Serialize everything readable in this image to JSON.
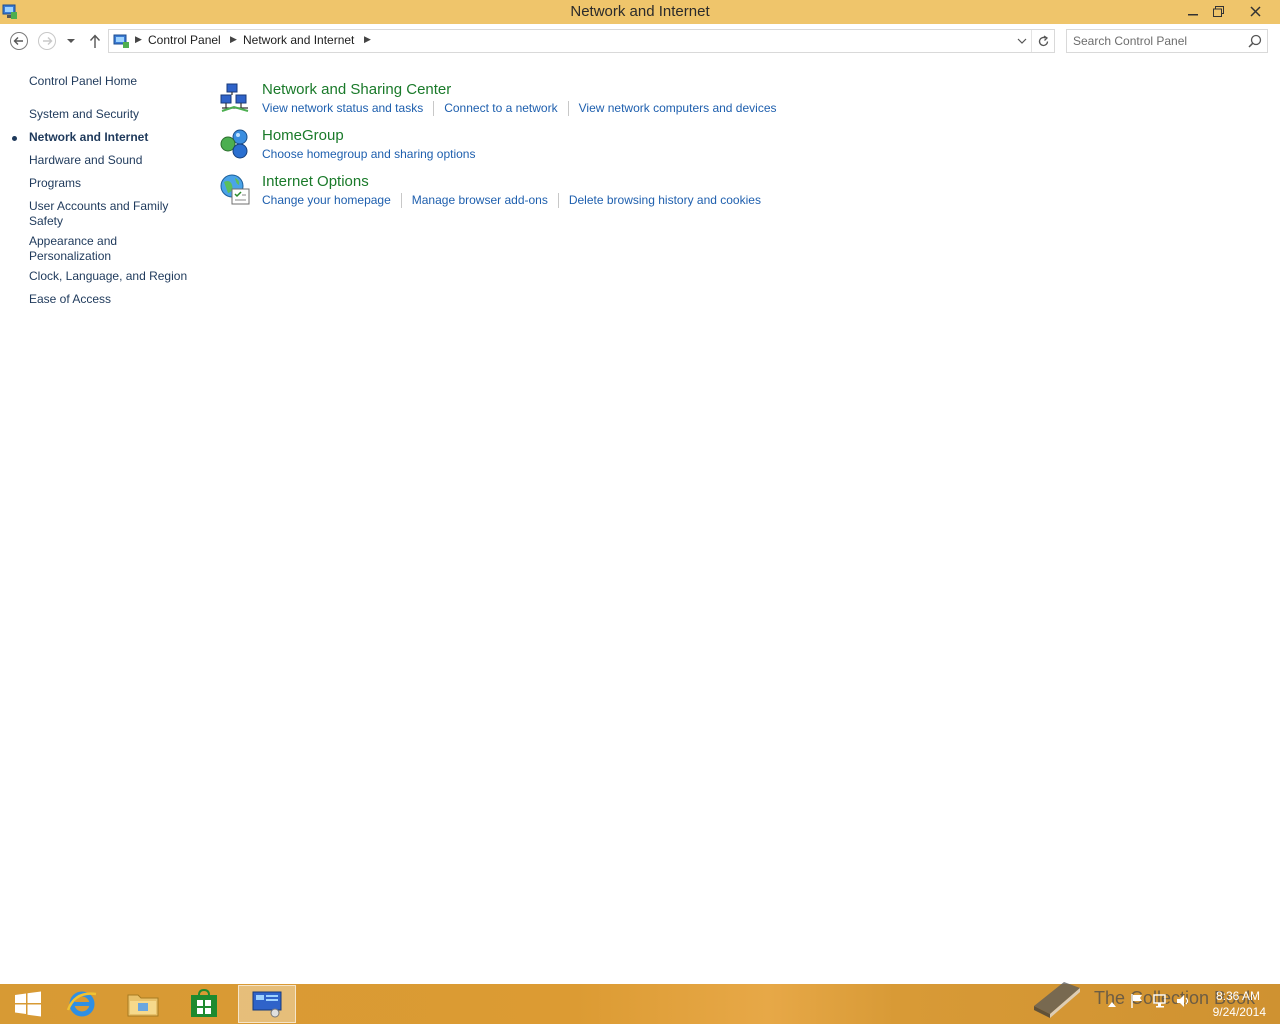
{
  "window": {
    "title": "Network and Internet"
  },
  "address": {
    "breadcrumbs": [
      "Control Panel",
      "Network and Internet"
    ]
  },
  "search": {
    "placeholder": "Search Control Panel"
  },
  "sidebar": {
    "items": [
      {
        "label": "Control Panel Home"
      },
      {
        "label": "System and Security"
      },
      {
        "label": "Network and Internet",
        "active": true
      },
      {
        "label": "Hardware and Sound"
      },
      {
        "label": "Programs"
      },
      {
        "label": "User Accounts and Family Safety"
      },
      {
        "label": "Appearance and Personalization"
      },
      {
        "label": "Clock, Language, and Region"
      },
      {
        "label": "Ease of Access"
      }
    ]
  },
  "categories": [
    {
      "title": "Network and Sharing Center",
      "icon": "network-sharing-icon",
      "links": [
        "View network status and tasks",
        "Connect to a network",
        "View network computers and devices"
      ]
    },
    {
      "title": "HomeGroup",
      "icon": "homegroup-icon",
      "links": [
        "Choose homegroup and sharing options"
      ]
    },
    {
      "title": "Internet Options",
      "icon": "internet-options-icon",
      "links": [
        "Change your homepage",
        "Manage browser add-ons",
        "Delete browsing history and cookies"
      ]
    }
  ],
  "taskbar": {
    "date": "9/24/2014",
    "time": "8:36 AM",
    "watermark": "The Collection Book"
  },
  "colors": {
    "titlebar": "#efc56b",
    "taskbar": "#d79a34",
    "category_title": "#1a7a2a",
    "link": "#1e5fae"
  }
}
